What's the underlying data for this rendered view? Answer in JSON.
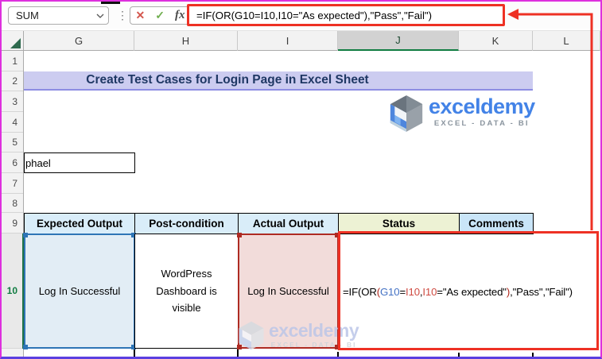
{
  "formula_bar": {
    "name_box_value": "SUM",
    "dots_glyph": "⋮",
    "cancel_glyph": "✕",
    "enter_glyph": "✓",
    "insert_function_label": "fx",
    "formula": "=IF(OR(G10=I10,I10=\"As expected\"),\"Pass\",\"Fail\")"
  },
  "grid": {
    "columns": [
      "G",
      "H",
      "I",
      "J",
      "K",
      "L"
    ],
    "selected_column": "J",
    "rows": [
      "1",
      "2",
      "3",
      "4",
      "5",
      "6",
      "7",
      "8",
      "9",
      "10"
    ],
    "selected_row": "10"
  },
  "sheet": {
    "banner_title": "Create Test Cases for Login Page in Excel Sheet",
    "logo": {
      "brand": "exceldemy",
      "tagline": "EXCEL - DATA - BI"
    },
    "cell_g6": "phael",
    "header_row9": [
      "Expected Output",
      "Post-condition",
      "Actual Output",
      "Status",
      "Comments"
    ],
    "row10": {
      "expected_output": "Log In Successful",
      "post_condition": "WordPress Dashboard is visible",
      "actual_output": "Log In Successful",
      "status_formula_parts": [
        {
          "t": "=IF(OR",
          "c": "black"
        },
        {
          "t": "(",
          "c": "paren-red"
        },
        {
          "t": "G10",
          "c": "blue"
        },
        {
          "t": "=",
          "c": "black"
        },
        {
          "t": "I10",
          "c": "red"
        },
        {
          "t": ",",
          "c": "black"
        },
        {
          "t": "I10",
          "c": "red"
        },
        {
          "t": "=\"As expected\"",
          "c": "black"
        },
        {
          "t": ")",
          "c": "paren-red"
        },
        {
          "t": ",\"Pass\",\"Fail\")",
          "c": "black"
        }
      ]
    },
    "watermark": {
      "brand": "exceldemy",
      "tagline": "EXCEL - DATA - BI"
    }
  },
  "colors": {
    "annotation_red": "#EE3124",
    "selection_green": "#107C41",
    "reference_blue": "#4472C4",
    "reference_red": "#CF4B42",
    "paren_red": "#B02418",
    "title_bg": "#CCCCF0",
    "title_text": "#1F3864",
    "header_blue_fill": "#D9EDF9",
    "status_fill": "#EDF2D4",
    "comments_fill": "#C9E5F8",
    "g10_fill": "#E2EDF5",
    "g10_border": "#2E75B6",
    "i10_fill": "#F2DCDA",
    "i10_border": "#AE2B23",
    "brand_blue": "#4383E7",
    "image_border": "#DE30DE",
    "image_border_bottom": "#5B3FE0"
  }
}
